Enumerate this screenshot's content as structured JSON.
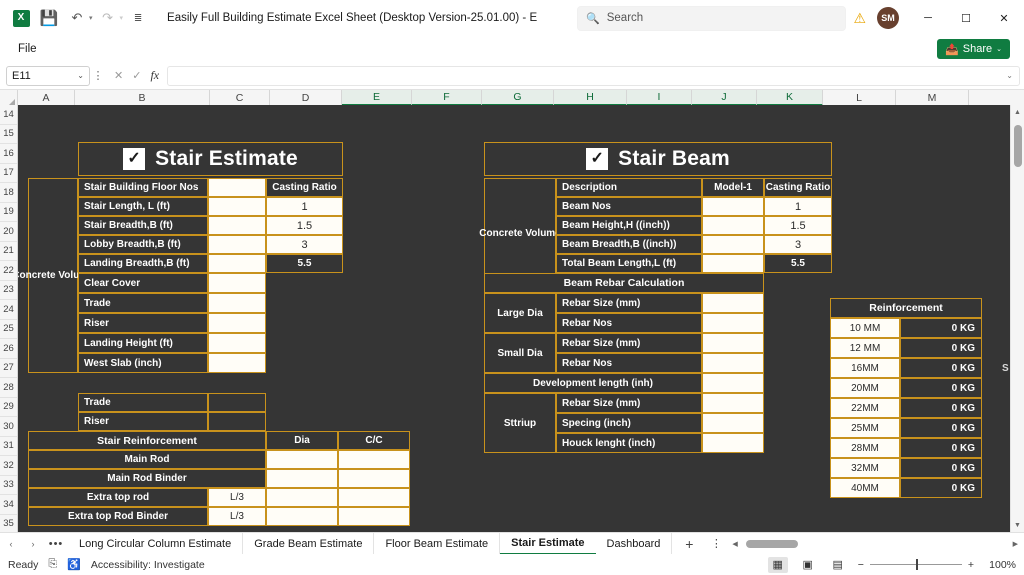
{
  "titlebar": {
    "app_icon": "excel-logo",
    "app_icon_letter": "X",
    "save_icon": "save-icon",
    "undo_icon": "undo-icon",
    "redo_icon": "redo-icon",
    "customize_icon": "customize-toolbar-icon",
    "document_title": "Easily Full Building Estimate Excel Sheet (Desktop Version-25.01.00)  -  E...",
    "search_placeholder": "Search",
    "search_icon": "search-icon",
    "warning_icon": "warning-icon",
    "avatar_initials": "SM",
    "minimize": "─",
    "maximize": "☐",
    "close": "✕"
  },
  "ribbon": {
    "file_label": "File",
    "share_label": "Share",
    "share_caret": "⌄"
  },
  "formulabar": {
    "namebox_value": "E11",
    "namebox_caret": "⌄",
    "more_dots": "⋮",
    "cancel_icon": "✕",
    "enter_icon": "✓",
    "fx_icon": "fx",
    "formula_value": "",
    "expand_caret": "⌄"
  },
  "grid": {
    "columns": [
      "A",
      "B",
      "C",
      "D",
      "E",
      "F",
      "G",
      "H",
      "I",
      "J",
      "K",
      "L",
      "M"
    ],
    "selected_columns": [
      "E",
      "F",
      "G",
      "H",
      "I",
      "J",
      "K"
    ],
    "rows": [
      14,
      15,
      16,
      17,
      18,
      19,
      20,
      21,
      22,
      23,
      24,
      25,
      26,
      27,
      28,
      29,
      30,
      31,
      32,
      33,
      34,
      35
    ],
    "colors": {
      "sheet_bg": "#353535",
      "gold_border": "#c8921c",
      "cell_white": "#fffdf7",
      "text_light": "#ffffff",
      "accent_green": "#107c41"
    }
  },
  "stair_estimate": {
    "banner_title": "Stair Estimate",
    "banner_check": "✓",
    "row_label": "Concrete Volume",
    "header_right": "Casting Ratio",
    "rows": [
      {
        "label": "Stair Building Floor Nos",
        "value": "",
        "ratio": "Casting Ratio",
        "ratio_header": true
      },
      {
        "label": "Stair Length, L (ft)",
        "value": "",
        "ratio": "1"
      },
      {
        "label": "Stair Breadth,B (ft)",
        "value": "",
        "ratio": "1.5"
      },
      {
        "label": "Lobby Breadth,B (ft)",
        "value": "",
        "ratio": "3"
      },
      {
        "label": "Landing Breadth,B (ft)",
        "value": "",
        "ratio": "5.5",
        "ratio_dark": true
      },
      {
        "label": "Clear Cover",
        "value": ""
      },
      {
        "label": "Trade",
        "value": ""
      },
      {
        "label": "Riser",
        "value": ""
      },
      {
        "label": "Landing Height (ft)",
        "value": ""
      },
      {
        "label": "West Slab (inch)",
        "value": ""
      }
    ],
    "second_block": [
      {
        "label": "Trade",
        "value": ""
      },
      {
        "label": "Riser",
        "value": ""
      }
    ],
    "reinforcement_header": {
      "title": "Stair Reinforcement",
      "dia": "Dia",
      "cc": "C/C"
    },
    "reinforcement_rows": [
      {
        "label": "Main Rod",
        "mid": "",
        "dia": "",
        "cc": ""
      },
      {
        "label": "Main Rod Binder",
        "mid": "",
        "dia": "",
        "cc": ""
      },
      {
        "label": "Extra top rod",
        "mid": "L/3",
        "dia": "",
        "cc": ""
      },
      {
        "label": "Extra top Rod  Binder",
        "mid": "L/3",
        "dia": "",
        "cc": ""
      }
    ]
  },
  "stair_beam": {
    "banner_title": "Stair Beam",
    "banner_check": "✓",
    "row_label": "Concrete Volume",
    "headers": {
      "description": "Description",
      "model": "Model-1",
      "ratio": "Casting Ratio"
    },
    "rows": [
      {
        "label": "Beam Nos",
        "value": "",
        "ratio": "1"
      },
      {
        "label": "Beam Height,H ((inch))",
        "value": "",
        "ratio": "1.5"
      },
      {
        "label": "Beam Breadth,B ((inch))",
        "value": "",
        "ratio": "3"
      },
      {
        "label": "Total Beam Length,L (ft)",
        "value": "",
        "ratio": "5.5",
        "ratio_dark": true
      }
    ],
    "rebar_title": "Beam Rebar Calculation",
    "rebar_groups": [
      {
        "group": "Large Dia",
        "items": [
          {
            "label": "Rebar Size (mm)",
            "value": ""
          },
          {
            "label": "Rebar Nos",
            "value": ""
          }
        ]
      },
      {
        "group": "Small Dia",
        "items": [
          {
            "label": "Rebar Size (mm)",
            "value": ""
          },
          {
            "label": "Rebar Nos",
            "value": ""
          }
        ]
      }
    ],
    "development_length": {
      "label": "Development length (inh)",
      "value": ""
    },
    "stirrup_group": "Sttriup",
    "stirrup_rows": [
      {
        "label": "Rebar Size (mm)",
        "value": ""
      },
      {
        "label": "Specing (inch)",
        "value": ""
      },
      {
        "label": "Houck lenght (inch)",
        "value": ""
      }
    ]
  },
  "reinforcement_panel": {
    "title": "Reinforcement",
    "rows": [
      {
        "size": "10 MM",
        "weight": "0 KG"
      },
      {
        "size": "12 MM",
        "weight": "0 KG"
      },
      {
        "size": "16MM",
        "weight": "0 KG"
      },
      {
        "size": "20MM",
        "weight": "0 KG"
      },
      {
        "size": "22MM",
        "weight": "0 KG"
      },
      {
        "size": "25MM",
        "weight": "0 KG"
      },
      {
        "size": "28MM",
        "weight": "0 KG"
      },
      {
        "size": "32MM",
        "weight": "0 KG"
      },
      {
        "size": "40MM",
        "weight": "0 KG"
      }
    ],
    "edge_fragment": "S"
  },
  "tabbar": {
    "prev_icon": "‹",
    "next_icon": "›",
    "all_sheets_icon": "•••",
    "tabs": [
      {
        "label": "Long Circular Column Estimate",
        "active": false
      },
      {
        "label": "Grade Beam Estimate",
        "active": false
      },
      {
        "label": "Floor Beam Estimate",
        "active": false
      },
      {
        "label": "Stair Estimate",
        "active": true
      },
      {
        "label": "Dashboard",
        "active": false
      }
    ],
    "add_sheet_icon": "+",
    "tab_menu_icon": "⋮",
    "hscroll_left": "◀",
    "hscroll_right": "▶"
  },
  "statusbar": {
    "state": "Ready",
    "record_macro_icon": "record-macro-icon",
    "accessibility_icon": "accessibility-icon",
    "accessibility_label": "Accessibility: Investigate",
    "view_normal_icon": "normal-view-icon",
    "view_pagelayout_icon": "page-layout-icon",
    "view_pagebreak_icon": "page-break-icon",
    "zoom_out": "−",
    "zoom_in": "+",
    "zoom_level": "100%"
  }
}
